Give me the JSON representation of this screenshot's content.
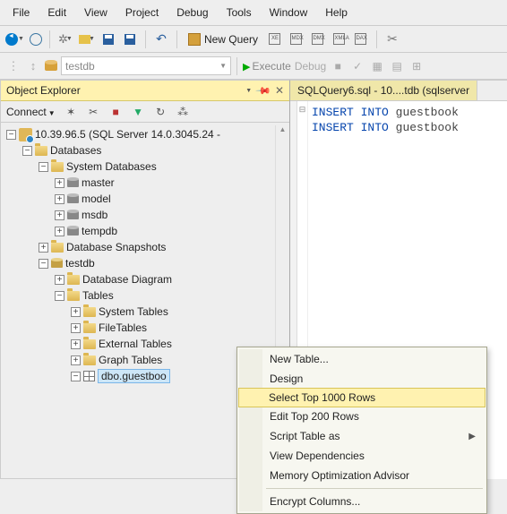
{
  "menu": {
    "file": "File",
    "edit": "Edit",
    "view": "View",
    "project": "Project",
    "debug": "Debug",
    "tools": "Tools",
    "window": "Window",
    "help": "Help"
  },
  "toolbar": {
    "new_query": "New Query"
  },
  "toolbar2": {
    "combo_value": "testdb",
    "execute": "Execute",
    "debug": "Debug"
  },
  "panel": {
    "title": "Object Explorer",
    "connect": "Connect",
    "server": "10.39.96.5 (SQL Server 14.0.3045.24 -",
    "databases": "Databases",
    "sysdb": "System Databases",
    "master": "master",
    "model": "model",
    "msdb": "msdb",
    "tempdb": "tempdb",
    "snapshots": "Database Snapshots",
    "testdb": "testdb",
    "diagrams": "Database Diagram",
    "tables": "Tables",
    "systables": "System Tables",
    "filetables": "FileTables",
    "external": "External Tables",
    "graph": "Graph Tables",
    "dbo_table": "dbo.guestboo"
  },
  "tab": {
    "title": "SQLQuery6.sql - 10....tdb (sqlserver"
  },
  "code": {
    "insert": "INSERT",
    "into": "INTO",
    "tbl": "guestbook"
  },
  "ctx": {
    "new_table": "New Table...",
    "design": "Design",
    "select_top": "Select Top 1000 Rows",
    "edit_top": "Edit Top 200 Rows",
    "script_as": "Script Table as",
    "view_dep": "View Dependencies",
    "mem_opt": "Memory Optimization Advisor",
    "encrypt": "Encrypt Columns..."
  }
}
